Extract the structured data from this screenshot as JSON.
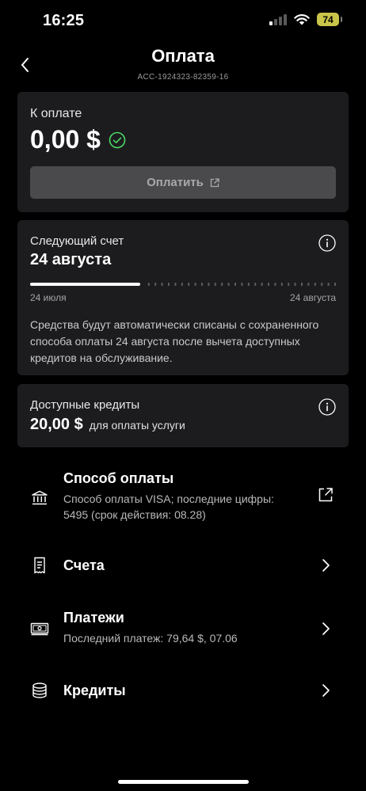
{
  "status_bar": {
    "time": "16:25",
    "battery": "74"
  },
  "header": {
    "title": "Оплата",
    "account_id": "ACC-1924323-82359-16"
  },
  "due": {
    "label": "К оплате",
    "amount": "0,00 $",
    "pay_button": "Оплатить"
  },
  "next_bill": {
    "label": "Следующий счет",
    "date": "24 августа",
    "range_start": "24 июля",
    "range_end": "24 августа",
    "progress_fraction": 0.36,
    "description": "Средства будут автоматически списаны с сохраненного способа оплаты 24 августа после вычета доступных кредитов на обслуживание."
  },
  "credits_card": {
    "label": "Доступные кредиты",
    "amount": "20,00 $",
    "note": "для оплаты услуги"
  },
  "menu": {
    "payment_method": {
      "title": "Способ оплаты",
      "subtitle": "Способ оплаты VISA; последние цифры: 5495 (срок действия: 08.28)"
    },
    "invoices": {
      "title": "Счета"
    },
    "payments": {
      "title": "Платежи",
      "subtitle": "Последний платеж: 79,64 $, 07.06"
    },
    "credits": {
      "title": "Кредиты"
    }
  },
  "icons": {
    "back": "chevron-left-icon",
    "check": "check-circle-icon",
    "external": "external-link-icon",
    "info": "info-icon",
    "bank": "bank-icon",
    "receipt": "receipt-icon",
    "cash": "banknote-icon",
    "coins": "coins-icon",
    "chevron": "chevron-right-icon"
  },
  "colors": {
    "background": "#000000",
    "card": "#1c1c1e",
    "accent_check": "#4cd964",
    "button_disabled": "#4a4a4c"
  }
}
